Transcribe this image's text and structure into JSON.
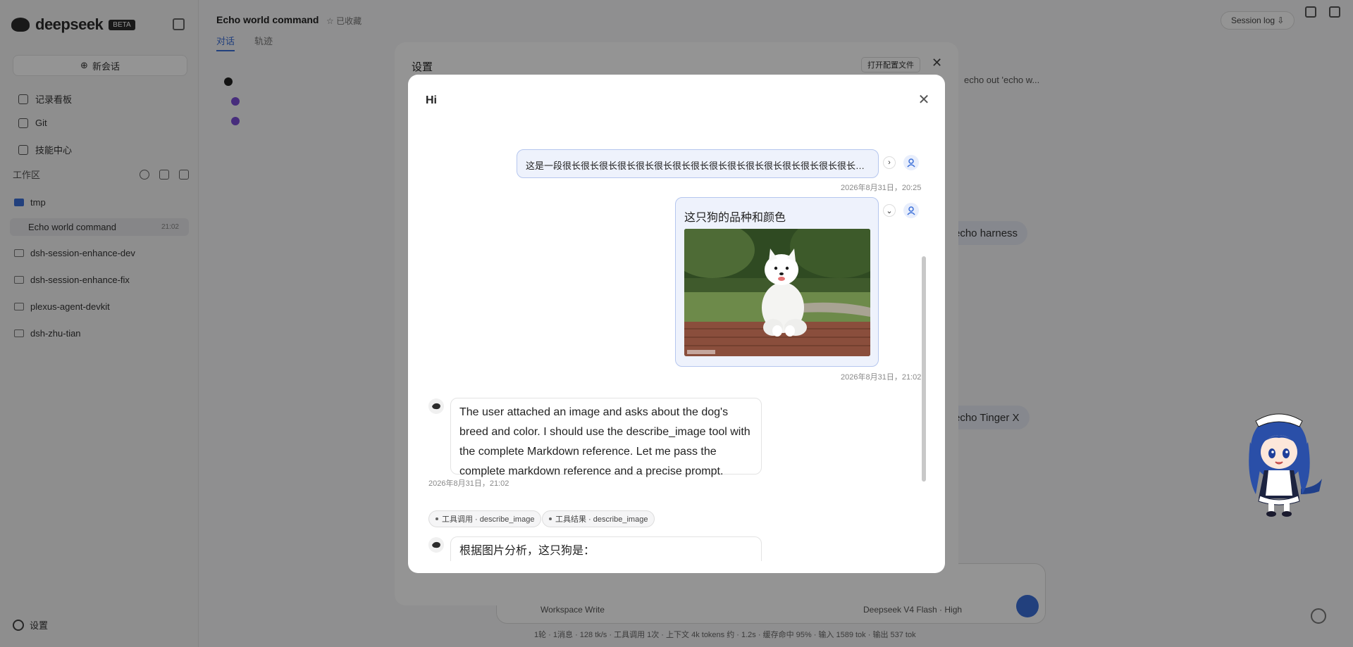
{
  "sidebar": {
    "logo_text": "deepseek",
    "logo_badge": "BETA",
    "new_chat": "新会话",
    "nav": [
      {
        "label": "记录看板"
      },
      {
        "label": "Git"
      },
      {
        "label": "技能中心"
      }
    ],
    "workspace_heading": "工作区",
    "workspaces": [
      {
        "label": "tmp"
      },
      {
        "label": "dsh-session-enhance-dev"
      },
      {
        "label": "dsh-session-enhance-fix"
      },
      {
        "label": "plexus-agent-devkit"
      },
      {
        "label": "dsh-zhu-tian"
      }
    ],
    "active_session": {
      "label": "Echo world command",
      "badge": "21:02"
    },
    "settings": "设置"
  },
  "main": {
    "title": "Echo world command",
    "title_meta": "☆ 已收藏",
    "tabs": [
      "对话",
      "轨迹"
    ],
    "session_log": "Session log ⇩",
    "snippet_right": "echo out 'echo w...",
    "pill_1": "echo harness",
    "pill_2": "echo Tinger X",
    "status_bar": "1轮 · 1消息 · 128 tk/s · 工具调用 1次 · 上下文 4k tokens 约 · 1.2s · 缓存命中 95% · 输入 1589 tok · 输出 537 tok",
    "composer_workspace": "Workspace Write",
    "composer_model": "Deepseek V4 Flash · High"
  },
  "settings_dialog": {
    "title": "设置",
    "open_file": "打开配置文件",
    "close": "✕"
  },
  "modal": {
    "title": "Hi",
    "close": "✕",
    "messages": {
      "user1_text": "这是一段很长很长很长很长很长很长很长很长很长很长很长很长很长很长很长很长很长很长很长很长很长很长很长很长很长…",
      "user1_time": "2026年8月31日，20:25",
      "user2_text": "这只狗的品种和颜色",
      "user2_time": "2026年8月31日，21:02",
      "bot1_text": "The user attached an image and asks about the dog's breed and color. I should use the describe_image tool with the complete Markdown reference. Let me pass the complete markdown reference and a precise prompt.",
      "bot1_time": "2026年8月31日，21:02",
      "tool_call": "工具调用 · describe_image",
      "tool_result": "工具结果 · describe_image",
      "bot2_text": "根据图片分析，这只狗是："
    }
  },
  "colors": {
    "accent": "#3b6fd8",
    "user_bubble_bg": "#eef2fc",
    "user_bubble_border": "#b5c6ee"
  }
}
